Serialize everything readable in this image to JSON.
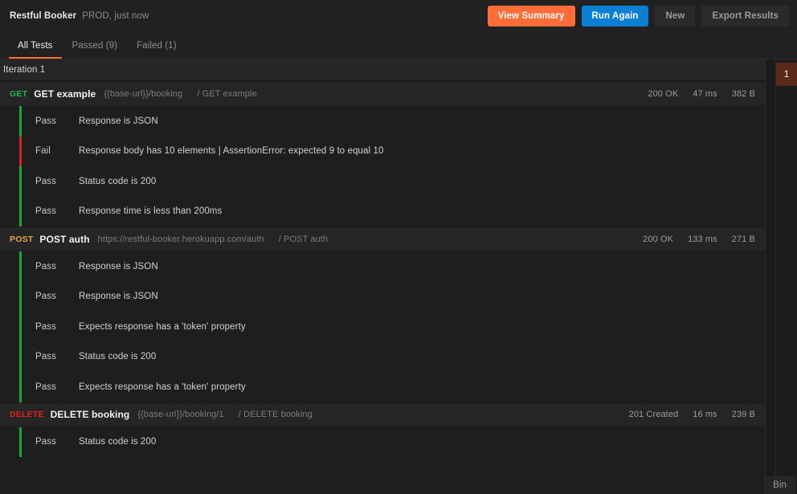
{
  "topbar": {
    "run_title": "Restful Booker",
    "run_meta": "PROD, just now",
    "buttons": [
      {
        "label": "View Summary",
        "style": "primary",
        "name": "view-summary-button"
      },
      {
        "label": "Run Again",
        "style": "blue",
        "name": "run-again-button"
      },
      {
        "label": "New",
        "style": "ghost",
        "name": "new-button"
      },
      {
        "label": "Export Results",
        "style": "ghost",
        "name": "export-results-button"
      }
    ]
  },
  "tabs": [
    {
      "label": "All Tests",
      "active": true,
      "name": "tab-all-tests"
    },
    {
      "label": "Passed (9)",
      "active": false,
      "name": "tab-passed"
    },
    {
      "label": "Failed (1)",
      "active": false,
      "name": "tab-failed"
    }
  ],
  "iteration": {
    "label": "Iteration 1"
  },
  "requests": [
    {
      "method": "GET",
      "method_color": "#19b554",
      "name": "GET example",
      "url": "{{base-url}}/booking",
      "path": "/ GET example",
      "status": "200 OK",
      "time": "47 ms",
      "size": "382 B",
      "tests": [
        {
          "status": "Pass",
          "name": "Response is JSON"
        },
        {
          "status": "Fail",
          "name": "Response body has 10 elements | AssertionError: expected 9 to equal 10"
        },
        {
          "status": "Pass",
          "name": "Status code is 200"
        },
        {
          "status": "Pass",
          "name": "Response time is less than 200ms"
        }
      ]
    },
    {
      "method": "POST",
      "method_color": "#e8a33d",
      "name": "POST auth",
      "url": "https://restful-booker.herokuapp.com/auth",
      "path": "/ POST auth",
      "status": "200 OK",
      "time": "133 ms",
      "size": "271 B",
      "tests": [
        {
          "status": "Pass",
          "name": "Response is JSON"
        },
        {
          "status": "Pass",
          "name": "Response is JSON"
        },
        {
          "status": "Pass",
          "name": "Expects response has a 'token' property"
        },
        {
          "status": "Pass",
          "name": "Status code is 200"
        },
        {
          "status": "Pass",
          "name": "Expects response has a 'token' property"
        }
      ]
    },
    {
      "method": "DELETE",
      "method_color": "#e0211c",
      "name": "DELETE booking",
      "url": "{{base-url}}/booking/1",
      "path": "/ DELETE booking",
      "status": "201 Created",
      "time": "16 ms",
      "size": "239 B",
      "tests": [
        {
          "status": "Pass",
          "name": "Status code is 200"
        }
      ]
    }
  ],
  "minimap": {
    "badge": "1"
  },
  "bin": {
    "label": "Bin"
  }
}
